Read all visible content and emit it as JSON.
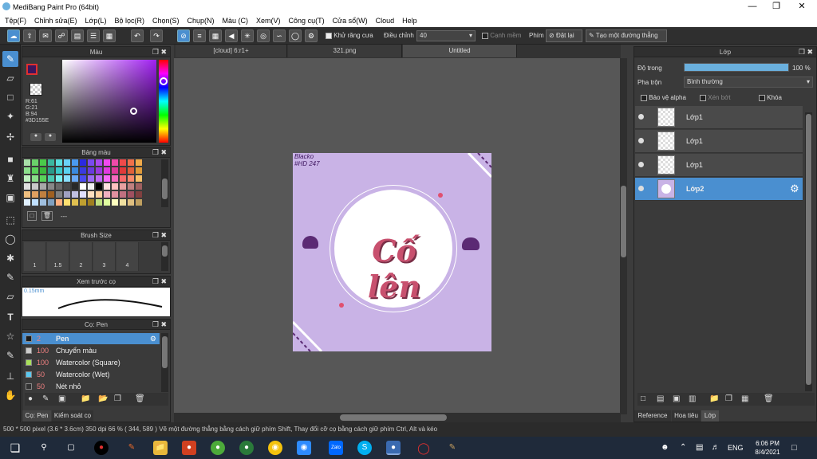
{
  "window": {
    "title": "MediBang Paint Pro (64bit)"
  },
  "menu": [
    "Tệp(F)",
    "Chỉnh sửa(E)",
    "Lớp(L)",
    "Bộ lọc(R)",
    "Chọn(S)",
    "Chụp(N)",
    "Màu (C)",
    "Xem(V)",
    "Công cụ(T)",
    "Cửa sổ(W)",
    "Cloud",
    "Help"
  ],
  "toolbar": {
    "antialias_label": "Khử răng cưa",
    "correction_label": "Điều chỉnh",
    "correction_value": "40",
    "edge_label": "Cạnh mềm",
    "key_label": "Phím",
    "reset_label": "Đặt lại",
    "straight_label": "Tạo một đường thẳng"
  },
  "panels": {
    "color": {
      "title": "Màu",
      "r": "R:61",
      "g": "G:21",
      "b": "B:94",
      "hex": "#3D155E"
    },
    "palette": {
      "title": "Bảng màu",
      "footer": "---"
    },
    "brush_size": {
      "title": "Brush Size",
      "sizes": [
        "1",
        "1.5",
        "2",
        "3",
        "4"
      ]
    },
    "preview": {
      "title": "Xem trước cọ",
      "size": "0.15mm"
    },
    "brush": {
      "title": "Cọ: Pen",
      "items": [
        {
          "size": "2",
          "name": "Pen",
          "color": "#1a1a1a"
        },
        {
          "size": "100",
          "name": "Chuyển màu",
          "color": "#cccccc"
        },
        {
          "size": "100",
          "name": "Watercolor (Square)",
          "color": "#a8e05a"
        },
        {
          "size": "50",
          "name": "Watercolor (Wet)",
          "color": "#5ac8f0"
        },
        {
          "size": "50",
          "name": "Nét nhỏ",
          "color": "#333333"
        }
      ],
      "tabs": [
        "Cọ: Pen",
        "Kiểm soát cọ"
      ]
    },
    "layer": {
      "title": "Lớp",
      "opacity_label": "Độ trong",
      "opacity_value": "100 %",
      "opacity": 1.0,
      "blend_label": "Pha trộn",
      "blend_value": "Bình thường",
      "protect_alpha": "Bảo vệ alpha",
      "clip": "Xén bớt",
      "lock": "Khóa",
      "layers": [
        "Lớp1",
        "Lớp1",
        "Lớp1",
        "Lớp2"
      ],
      "tabs": [
        "Reference",
        "Hoa tiêu",
        "Lớp"
      ]
    }
  },
  "canvas": {
    "tabs": [
      "[cloud] 6:r1+",
      "321.png",
      "Untitled"
    ],
    "art_text": "Cố lên",
    "corner_text": "Blacko #HD 247"
  },
  "status": "500 * 500 pixel  (3.6 * 3.6cm)  350 dpi  66 %  ( 344, 589 )  Vẽ một đường thẳng bằng cách giữ phím Shift, Thay đổi cỡ cọ bằng cách giữ phím Ctrl, Alt và kéo",
  "taskbar": {
    "lang": "ENG",
    "time": "6:06 PM",
    "date": "8/4/2021"
  },
  "colors": {
    "accent": "#4a8fd0",
    "canvas_bg": "#c9b3e6",
    "ink": "#c8506e"
  }
}
